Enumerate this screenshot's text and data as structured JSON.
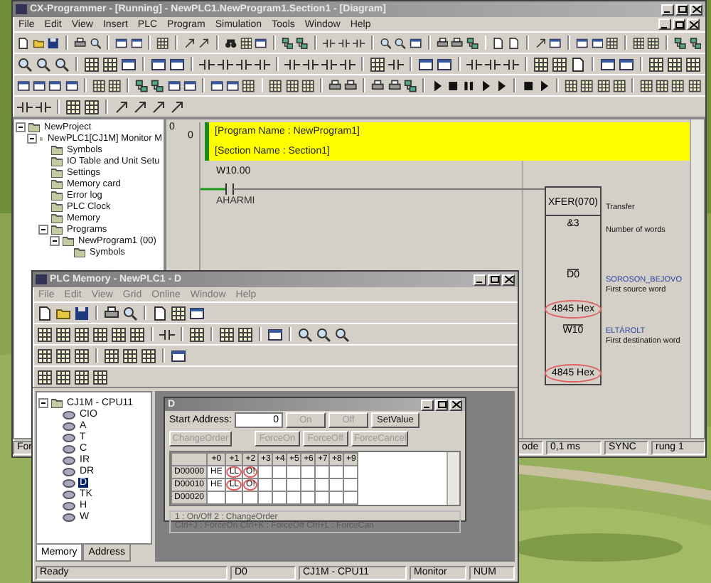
{
  "main_window": {
    "title": "CX-Programmer - [Running] - NewPLC1.NewProgram1.Section1 - [Diagram]",
    "menu": [
      "File",
      "Edit",
      "View",
      "Insert",
      "PLC",
      "Program",
      "Simulation",
      "Tools",
      "Window",
      "Help"
    ],
    "project_tree": [
      {
        "label": "NewProject",
        "expanded": true,
        "children": [
          {
            "label": "NewPLC1[CJ1M] Monitor M",
            "expanded": true,
            "children": [
              {
                "label": "Symbols"
              },
              {
                "label": "IO Table and Unit Setu"
              },
              {
                "label": "Settings"
              },
              {
                "label": "Memory card"
              },
              {
                "label": "Error log"
              },
              {
                "label": "PLC Clock"
              },
              {
                "label": "Memory"
              },
              {
                "label": "Programs",
                "expanded": true,
                "children": [
                  {
                    "label": "NewProgram1 (00)",
                    "expanded": true,
                    "children": [
                      {
                        "label": "Symbols"
                      }
                    ]
                  }
                ]
              }
            ]
          }
        ]
      }
    ],
    "diagram": {
      "rung_number": "0",
      "step_number": "0",
      "header": [
        "[Program Name : NewProgram1]",
        "[Section Name : Section1]"
      ],
      "contact": {
        "address": "W10.00",
        "comment": "AHARMI"
      },
      "instruction": {
        "mnemonic": "XFER(070)",
        "comment": "Transfer"
      },
      "operands": [
        {
          "value": "&3",
          "description": "Number of words"
        },
        {
          "value": "D0",
          "symbol": "SOROSON_BEJOVO",
          "description": "First source word",
          "monitor": "4845 Hex",
          "circled": true
        },
        {
          "value": "W10",
          "symbol": "ELTÁROLT",
          "description": "First destination word",
          "monitor": "4845 Hex",
          "circled": true
        }
      ]
    },
    "status_bar": [
      "For",
      "ode",
      "0,1 ms",
      "SYNC",
      "rung 1"
    ]
  },
  "memory_window": {
    "title": "PLC Memory - NewPLC1 - D",
    "menu": [
      "File",
      "Edit",
      "View",
      "Grid",
      "Online",
      "Window",
      "Help"
    ],
    "tree": [
      {
        "label": "CJ1M - CPU11",
        "expanded": true,
        "selected": false,
        "children": [
          {
            "label": "CIO",
            "selected": false
          },
          {
            "label": "A",
            "selected": false
          },
          {
            "label": "T",
            "selected": false
          },
          {
            "label": "C",
            "selected": false
          },
          {
            "label": "IR",
            "selected": false
          },
          {
            "label": "DR",
            "selected": false
          },
          {
            "label": "D",
            "selected": true
          },
          {
            "label": "TK",
            "selected": false
          },
          {
            "label": "H",
            "selected": false
          },
          {
            "label": "W",
            "selected": false
          }
        ]
      }
    ],
    "tabs": [
      {
        "label": "Memory",
        "selected": true
      },
      {
        "label": "Address",
        "selected": false
      }
    ],
    "area_window": {
      "title": "D",
      "start_address_label": "Start Address:",
      "start_address": "0",
      "buttons": [
        {
          "label": "On",
          "disabled": true
        },
        {
          "label": "Off",
          "disabled": true
        },
        {
          "label": "SetValue",
          "disabled": false
        },
        {
          "label": "ChangeOrder",
          "disabled": true
        },
        {
          "label": "ForceOn",
          "disabled": true
        },
        {
          "label": "ForceOff",
          "disabled": true
        },
        {
          "label": "ForceCancel",
          "disabled": true
        }
      ],
      "columns": [
        "+0",
        "+1",
        "+2",
        "+3",
        "+4",
        "+5",
        "+6",
        "+7",
        "+8",
        "+9"
      ],
      "rows": [
        {
          "address": "D00000",
          "cells": [
            {
              "text": "HE",
              "circled": false
            },
            {
              "text": "LL",
              "circled": true
            },
            {
              "text": "O!",
              "circled": true
            }
          ]
        },
        {
          "address": "D00010",
          "cells": [
            {
              "text": "HE",
              "circled": false
            },
            {
              "text": "LL",
              "circled": true
            },
            {
              "text": "O!",
              "circled": true
            }
          ]
        },
        {
          "address": "D00020"
        }
      ],
      "legend": [
        "1 : On/Off     2 : ChangeOrder",
        "Ctrl+J : ForceOn   Ctrl+K : ForceOff   Ctrl+L : ForceCan"
      ]
    },
    "status_bar": [
      "Ready",
      "D0",
      "CJ1M - CPU11",
      "Monitor",
      "NUM"
    ]
  }
}
